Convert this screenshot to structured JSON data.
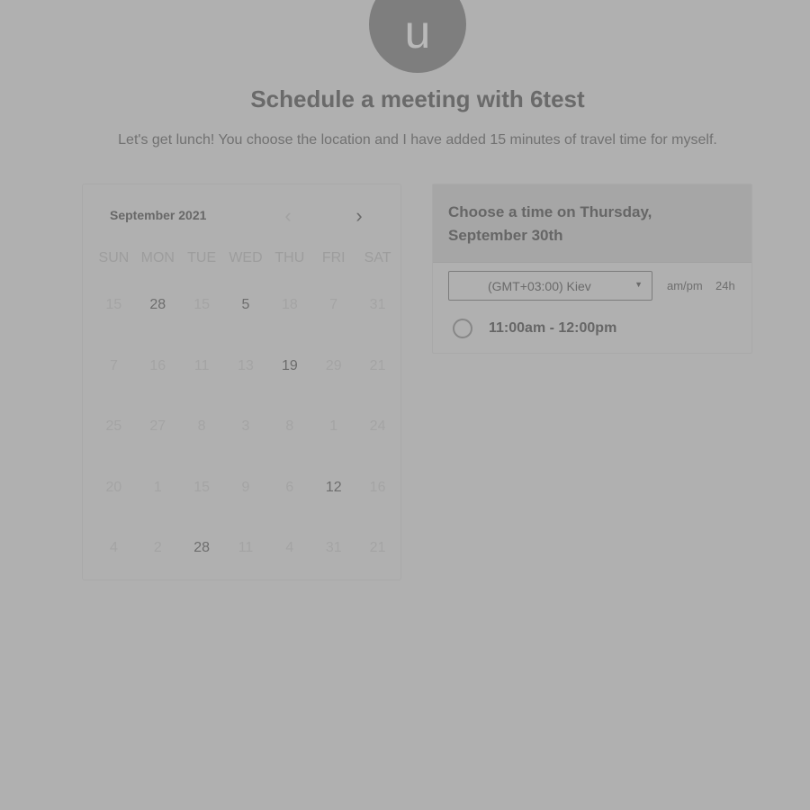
{
  "avatar": {
    "initial": "u"
  },
  "header": {
    "title": "Schedule a meeting with 6test",
    "subtitle": "Let's get lunch! You choose the location and I have added 15 minutes of travel time for myself."
  },
  "calendar": {
    "month_label": "September 2021",
    "prev_icon": "chevron-left-icon",
    "next_icon": "chevron-right-icon",
    "weekdays": [
      "SUN",
      "MON",
      "TUE",
      "WED",
      "THU",
      "FRI",
      "SAT"
    ],
    "days": [
      {
        "label": "15",
        "active": false
      },
      {
        "label": "28",
        "active": true
      },
      {
        "label": "15",
        "active": false
      },
      {
        "label": "5",
        "active": true
      },
      {
        "label": "18",
        "active": false
      },
      {
        "label": "7",
        "active": false
      },
      {
        "label": "31",
        "active": false
      },
      {
        "label": "7",
        "active": false
      },
      {
        "label": "16",
        "active": false
      },
      {
        "label": "11",
        "active": false
      },
      {
        "label": "13",
        "active": false
      },
      {
        "label": "19",
        "active": true
      },
      {
        "label": "29",
        "active": false
      },
      {
        "label": "21",
        "active": false
      },
      {
        "label": "25",
        "active": false
      },
      {
        "label": "27",
        "active": false
      },
      {
        "label": "8",
        "active": false
      },
      {
        "label": "3",
        "active": false
      },
      {
        "label": "8",
        "active": false
      },
      {
        "label": "1",
        "active": false
      },
      {
        "label": "24",
        "active": false
      },
      {
        "label": "20",
        "active": false
      },
      {
        "label": "1",
        "active": false
      },
      {
        "label": "15",
        "active": false
      },
      {
        "label": "9",
        "active": false
      },
      {
        "label": "6",
        "active": false
      },
      {
        "label": "12",
        "active": true
      },
      {
        "label": "16",
        "active": false
      },
      {
        "label": "4",
        "active": false
      },
      {
        "label": "2",
        "active": false
      },
      {
        "label": "28",
        "active": true
      },
      {
        "label": "11",
        "active": false
      },
      {
        "label": "4",
        "active": false
      },
      {
        "label": "31",
        "active": false
      },
      {
        "label": "21",
        "active": false
      }
    ]
  },
  "time_panel": {
    "heading_line1": "Choose a time on Thursday,",
    "heading_line2": "September 30th",
    "timezone": "(GMT+03:00) Kiev",
    "format_ampm": "am/pm",
    "format_24h": "24h",
    "slots": [
      "11:00am - 12:00pm"
    ]
  },
  "colors": {
    "background": "#b0b0b0",
    "avatar": "#7e7e7e"
  }
}
